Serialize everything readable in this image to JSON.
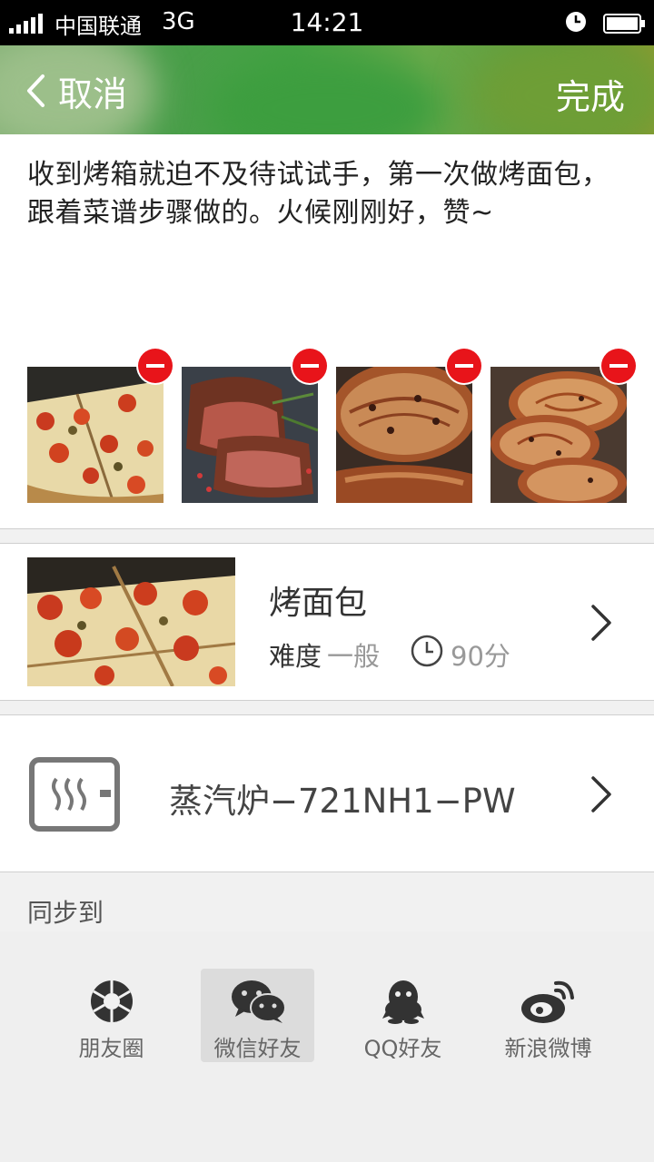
{
  "status_bar": {
    "carrier": "中国联通",
    "network": "3G",
    "time": "14:21"
  },
  "nav": {
    "back_label": "取消",
    "done_label": "完成"
  },
  "post": {
    "text": "收到烤箱就迫不及待试试手，第一次做烤面包，跟着菜谱步骤做的。火候刚刚好，赞~",
    "photos": [
      "pizza-photo",
      "steak-photo",
      "raisin-bread-photo",
      "raisin-bread-slices-photo"
    ]
  },
  "recipe": {
    "title": "烤面包",
    "difficulty_label": "难度",
    "difficulty_value": "一般",
    "duration": "90分"
  },
  "device": {
    "name": "蒸汽炉−721NH1−PW"
  },
  "sync": {
    "label": "同步到",
    "targets": [
      {
        "label": "朋友圈",
        "icon": "moments-icon"
      },
      {
        "label": "微信好友",
        "icon": "wechat-icon",
        "selected": true
      },
      {
        "label": "QQ好友",
        "icon": "qq-icon"
      },
      {
        "label": "新浪微博",
        "icon": "weibo-icon"
      }
    ]
  },
  "colors": {
    "remove_red": "#e8141a",
    "nav_green": "#4a9e4a",
    "text_gray": "#999999"
  }
}
